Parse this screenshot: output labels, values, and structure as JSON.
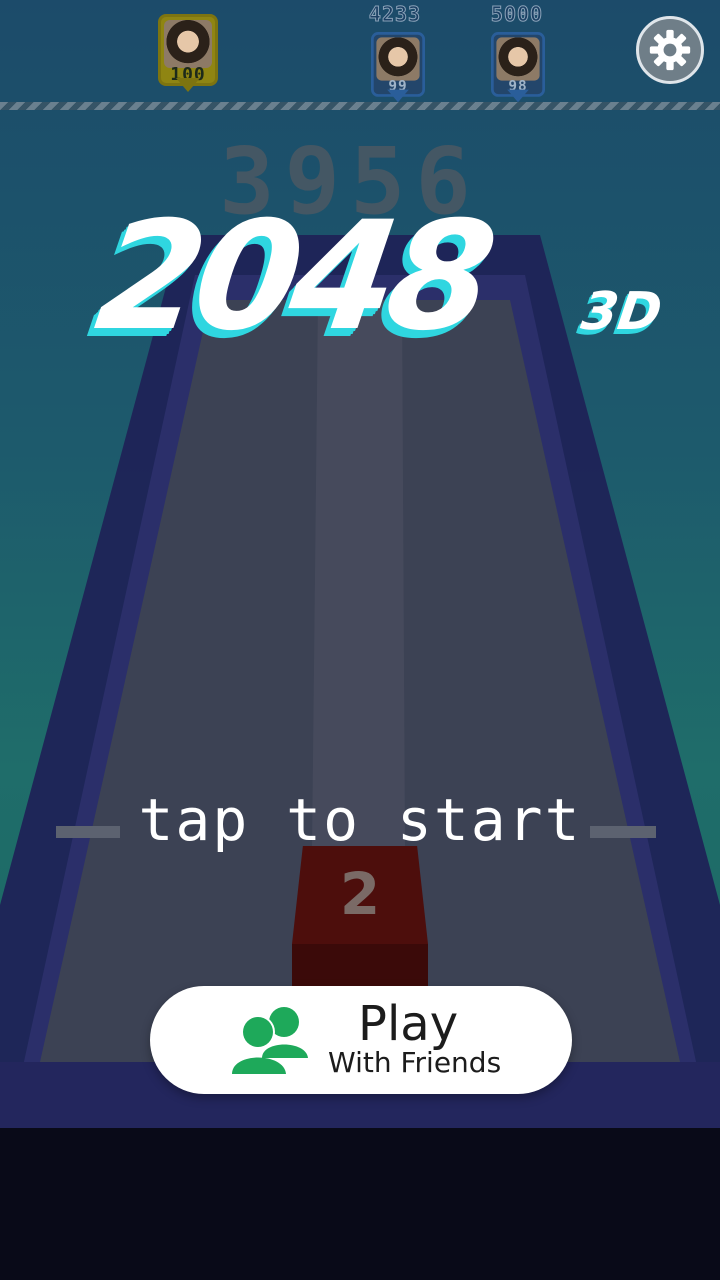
{
  "header": {
    "player_badge": {
      "level": "100"
    },
    "rivals": [
      {
        "score": "4233",
        "level": "99"
      },
      {
        "score": "5000",
        "level": "98"
      }
    ],
    "settings_icon": "gear-icon"
  },
  "game": {
    "best_score": "3956",
    "title_main": "2048",
    "title_sub": "3D",
    "prompt": "tap to start",
    "cube_value": "2"
  },
  "play_button": {
    "label": "Play",
    "sublabel": "With Friends",
    "icon": "friends-icon"
  },
  "colors": {
    "title_accent": "#2fd6e0",
    "friends_green": "#1ea95a",
    "cube_red": "#4d0e0c"
  }
}
